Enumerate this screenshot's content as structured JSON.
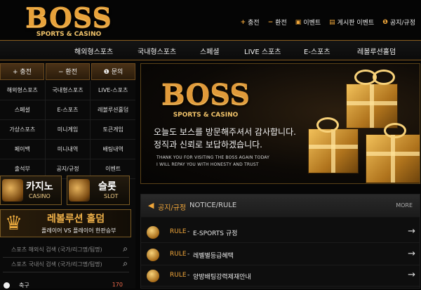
{
  "header": {
    "logo_main": "BOSS",
    "logo_sub": "SPORTS & CASINO",
    "links": [
      {
        "icon": "+",
        "label": "충전"
      },
      {
        "icon": "−",
        "label": "환전"
      },
      {
        "icon": "▣",
        "label": "이벤트"
      },
      {
        "icon": "▤",
        "label": "게시판 이벤트"
      },
      {
        "icon": "❶",
        "label": "공지/규정"
      }
    ]
  },
  "nav": [
    "해외형스포츠",
    "국내형스포츠",
    "스페셜",
    "LIVE 스포츠",
    "E-스포츠",
    "레볼루션홀덤"
  ],
  "sidebar": {
    "tabs": [
      {
        "icon": "+",
        "label": "충전"
      },
      {
        "icon": "−",
        "label": "환전"
      },
      {
        "icon": "❶",
        "label": "문의"
      }
    ],
    "grid": [
      [
        "해외형스포츠",
        "국내형스포츠",
        "LIVE-스포츠"
      ],
      [
        "스페셜",
        "E-스포츠",
        "레볼루션홀덤"
      ],
      [
        "가상스포츠",
        "미니게임",
        "토큰게임"
      ],
      [
        "페이백",
        "미니내역",
        "배팅내역"
      ],
      [
        "출석부",
        "공지/규정",
        "이벤트"
      ]
    ],
    "casino": {
      "title": "카지노",
      "sub": "CASINO"
    },
    "slot": {
      "title": "슬롯",
      "sub": "SLOT"
    },
    "revolution": {
      "title": "레볼루션 홀덤",
      "sub": "플레이어 VS 플레이어 한판승부"
    },
    "search1": "스포츠 해외식 검색 (국가/리그명/팀명)",
    "search2": "스포츠 국내식 검색 (국가/리그명/팀명)",
    "sport_row": {
      "name": "축구",
      "count": "170"
    }
  },
  "hero": {
    "logo_main": "BOSS",
    "logo_sub": "SPORTS & CASINO",
    "line1": "오늘도 보스를 방문해주셔서 감사합니다.",
    "line2": "정직과 신뢰로 보답하겠습니다.",
    "en1": "THANK YOU FOR VISITING THE BOSS AGAIN TODAY",
    "en2": "I WILL REPAY YOU WITH HONESTY AND TRUST"
  },
  "notice": {
    "title": "공지/규정",
    "title_en": "NOTICE/RULE",
    "more": "MORE",
    "items": [
      {
        "tag": "RULE",
        "text": "E-SPORTS 규정"
      },
      {
        "tag": "RULE",
        "text": "레벨별등급혜택"
      },
      {
        "tag": "RULE",
        "text": "양방배팅강력제재안내"
      }
    ]
  }
}
